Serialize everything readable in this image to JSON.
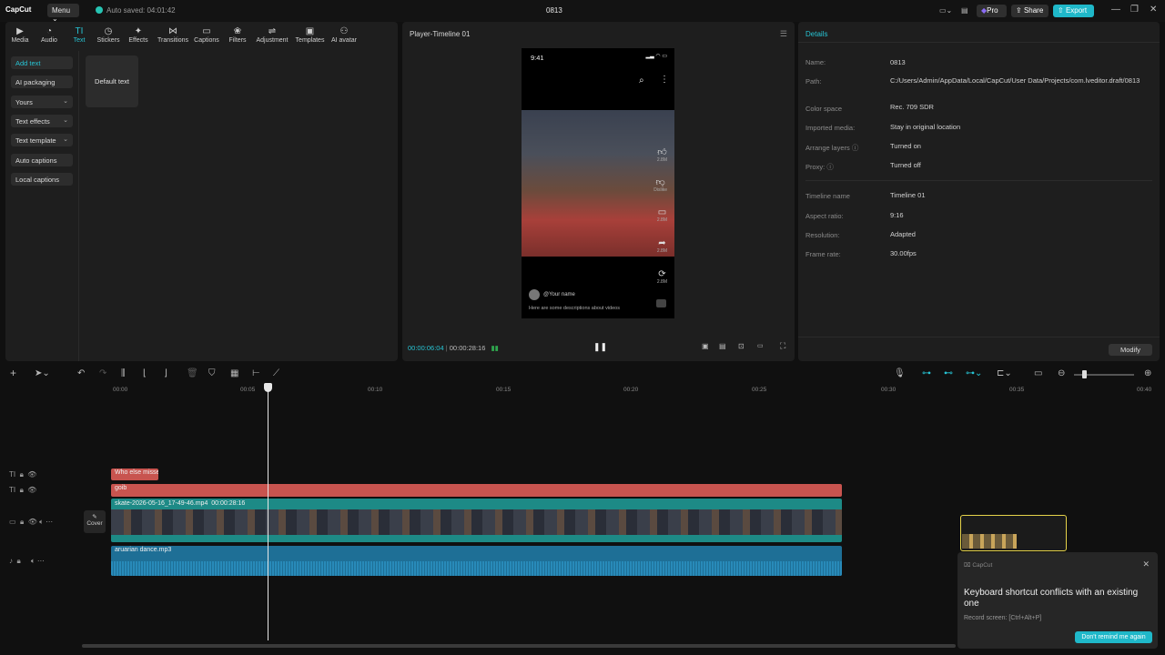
{
  "titlebar": {
    "logo": "CapCut",
    "menu_label": "Menu",
    "autosave": "Auto saved: 04:01:42",
    "project_name": "0813",
    "pro_label": "Pro",
    "share_label": "Share",
    "export_label": "Export"
  },
  "toolbar": {
    "tools": [
      {
        "label": "Media",
        "icon": "media-icon"
      },
      {
        "label": "Audio",
        "icon": "audio-icon"
      },
      {
        "label": "Text",
        "icon": "text-icon"
      },
      {
        "label": "Stickers",
        "icon": "stickers-icon"
      },
      {
        "label": "Effects",
        "icon": "effects-icon"
      },
      {
        "label": "Transitions",
        "icon": "transitions-icon"
      },
      {
        "label": "Captions",
        "icon": "captions-icon"
      },
      {
        "label": "Filters",
        "icon": "filters-icon"
      },
      {
        "label": "Adjustment",
        "icon": "adjustment-icon"
      },
      {
        "label": "Templates",
        "icon": "templates-icon"
      },
      {
        "label": "AI avatar",
        "icon": "ai-avatar-icon"
      }
    ],
    "active": "Text"
  },
  "sidebar": {
    "items": [
      {
        "label": "Add text"
      },
      {
        "label": "AI packaging"
      },
      {
        "label": "Yours"
      },
      {
        "label": "Text effects"
      },
      {
        "label": "Text template"
      },
      {
        "label": "Auto captions"
      },
      {
        "label": "Local captions"
      }
    ]
  },
  "text_panel": {
    "default_card": "Default text"
  },
  "player": {
    "title": "Player-Timeline 01",
    "phone_time": "9:41",
    "like_count": "2.8M",
    "dislike_label": "Dislike",
    "comment_count": "2.8M",
    "share_count": "2.8M",
    "remix_count": "2.8M",
    "username": "@Your name",
    "description": "Here are some descriptions about videos",
    "current_time": "00:00:06:04",
    "total_time": "00:00:28:16"
  },
  "details": {
    "header": "Details",
    "rows": [
      {
        "key": "Name:",
        "value": "0813"
      },
      {
        "key": "Path:",
        "value": "C:/Users/Admin/AppData/Local/CapCut/User Data/Projects/com.lveditor.draft/0813"
      },
      {
        "key": "Color space",
        "value": "Rec. 709 SDR"
      },
      {
        "key": "Imported media:",
        "value": "Stay in original location"
      },
      {
        "key": "Arrange layers",
        "value": "Turned on"
      },
      {
        "key": "Proxy:",
        "value": "Turned off"
      },
      {
        "key": "Timeline name",
        "value": "Timeline 01"
      },
      {
        "key": "Aspect ratio:",
        "value": "9:16"
      },
      {
        "key": "Resolution:",
        "value": "Adapted"
      },
      {
        "key": "Frame rate:",
        "value": "30.00fps"
      }
    ],
    "modify_label": "Modify"
  },
  "timeline": {
    "ruler": [
      "00:00",
      "00:05",
      "00:10",
      "00:15",
      "00:20",
      "00:25",
      "00:30",
      "00:35",
      "00:40"
    ],
    "clips": {
      "text1": "Who else misse",
      "text2": "goib",
      "video": "skate-2026-05-16_17-49-46.mp4",
      "video_duration": "00:00:28:16",
      "audio": "aruarian dance.mp3"
    },
    "cover_label": "Cover"
  },
  "toast": {
    "app": "CapCut",
    "message": "Keyboard shortcut conflicts with an existing one",
    "detail": "Record screen: [Ctrl+Alt+P]",
    "button": "Don't remind me again"
  },
  "colors": {
    "accent": "#27c4d4",
    "text_clip": "#c8544f",
    "video_clip": "#1d8a86",
    "audio_clip": "#1e6f96"
  }
}
